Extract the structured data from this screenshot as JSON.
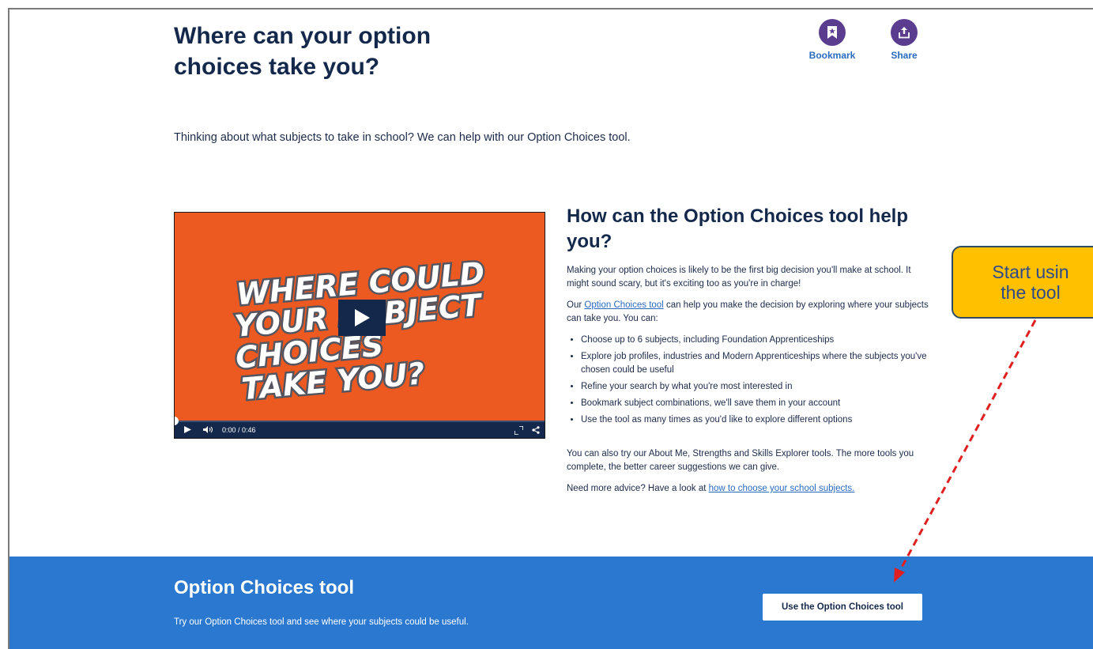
{
  "header": {
    "title": "Where can your option choices take you?",
    "bookmark_label": "Bookmark",
    "share_label": "Share"
  },
  "intro": "Thinking about what subjects to take in school? We can help with our Option Choices tool.",
  "video": {
    "art_lines": [
      "WHERE COULD",
      "YOUR SUBJECT",
      "CHOICES",
      "TAKE YOU?"
    ],
    "time": "0:00 / 0:46",
    "progress": 0,
    "background_color": "#ec5a22"
  },
  "content": {
    "heading": "How can the Option Choices tool help you?",
    "para1": "Making your option choices is likely to be the first big decision you'll make at school. It might sound scary, but it's exciting too as you're in charge!",
    "para2_before": "Our ",
    "para2_link": "Option Choices tool",
    "para2_after": " can help you make the decision by exploring where your subjects can take you. You can:",
    "bullets": [
      "Choose up to 6 subjects, including Foundation Apprenticeships",
      "Explore job profiles, industries and Modern Apprenticeships where the subjects you've chosen could be useful",
      "Refine your search by what you're most interested in",
      "Bookmark subject combinations, we'll save them in your account",
      "Use the tool as many times as you'd like to explore different options"
    ],
    "para3": "You can also try our About Me, Strengths and Skills Explorer tools. The more tools you complete, the better career suggestions we can give.",
    "para4_before": "Need more advice? Have a look at ",
    "para4_link": "how to choose your school subjects."
  },
  "banner": {
    "title": "Option Choices tool",
    "text": "Try our Option Choices tool and see where your subjects could be useful.",
    "button_label": "Use the Option Choices tool",
    "background_color": "#2b78d1"
  },
  "callout": {
    "line1": "Start usin",
    "line2": "the tool",
    "color": "#ffc000",
    "arrow_color": "#e02020"
  },
  "icons": {
    "bookmark": "bookmark-icon",
    "share": "share-icon",
    "play": "play-icon",
    "volume": "volume-icon",
    "fullscreen": "fullscreen-icon",
    "video_share": "share-icon"
  }
}
